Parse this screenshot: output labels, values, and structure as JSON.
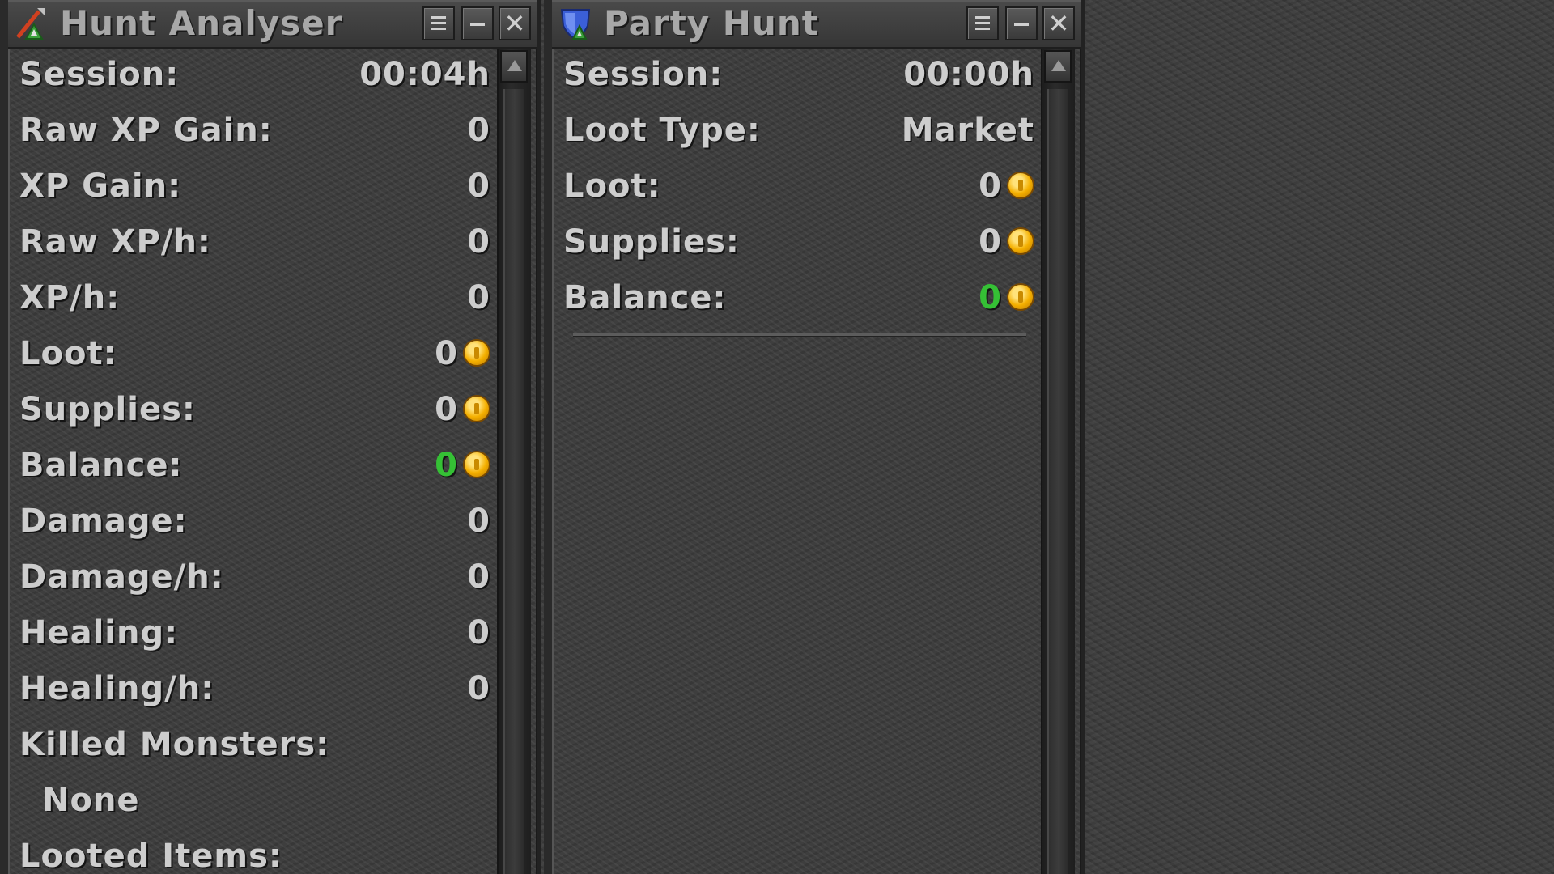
{
  "hunt_analyser": {
    "title": "Hunt Analyser",
    "icon": "hunt-analyser-icon",
    "stats": [
      {
        "label": "Session:",
        "value": "00:04h"
      },
      {
        "label": "Raw XP Gain:",
        "value": "0"
      },
      {
        "label": "XP Gain:",
        "value": "0"
      },
      {
        "label": "Raw XP/h:",
        "value": "0"
      },
      {
        "label": "XP/h:",
        "value": "0"
      }
    ],
    "loot": {
      "label": "Loot:",
      "value": "0"
    },
    "supplies": {
      "label": "Supplies:",
      "value": "0"
    },
    "balance": {
      "label": "Balance:",
      "value": "0",
      "color": "#35c035"
    },
    "stats2": [
      {
        "label": "Damage:",
        "value": "0"
      },
      {
        "label": "Damage/h:",
        "value": "0"
      },
      {
        "label": "Healing:",
        "value": "0"
      },
      {
        "label": "Healing/h:",
        "value": "0"
      }
    ],
    "killed_monsters": {
      "label": "Killed Monsters:",
      "value": "None"
    },
    "looted_items": {
      "label": "Looted Items:"
    }
  },
  "party_hunt": {
    "title": "Party Hunt",
    "icon": "party-hunt-shield-icon",
    "session": {
      "label": "Session:",
      "value": "00:00h"
    },
    "loot_type": {
      "label": "Loot Type:",
      "value": "Market"
    },
    "loot": {
      "label": "Loot:",
      "value": "0"
    },
    "supplies": {
      "label": "Supplies:",
      "value": "0"
    },
    "balance": {
      "label": "Balance:",
      "value": "0",
      "color": "#35c035"
    }
  },
  "coin_icon": "gold-coin-icon"
}
